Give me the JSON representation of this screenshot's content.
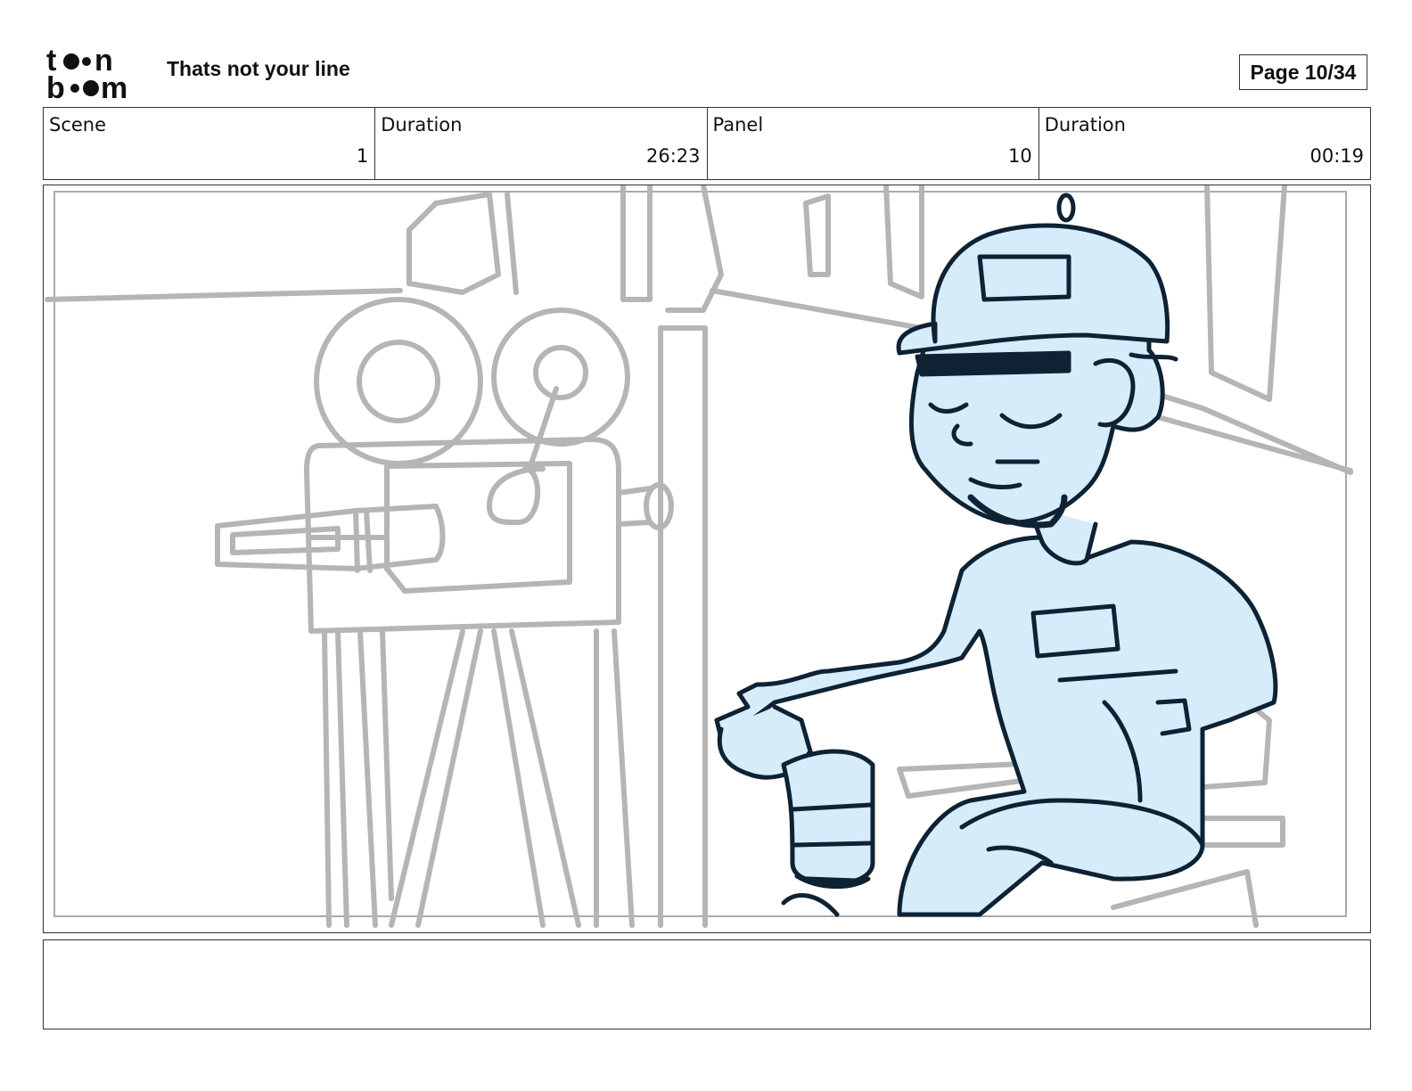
{
  "header": {
    "logo_text_top": "toon",
    "logo_text_bottom": "boom",
    "title": "Thats not your line",
    "page_indicator": "Page 10/34"
  },
  "info": [
    {
      "label": "Scene",
      "value": "1"
    },
    {
      "label": "Duration",
      "value": "26:23"
    },
    {
      "label": "Panel",
      "value": "10"
    },
    {
      "label": "Duration",
      "value": "00:19"
    }
  ],
  "panel": {
    "colors": {
      "sketch_gray": "#aaaaaa",
      "ink": "#0e2233",
      "fill_blue": "#d6ecfb"
    }
  },
  "notes": {
    "text": ""
  }
}
